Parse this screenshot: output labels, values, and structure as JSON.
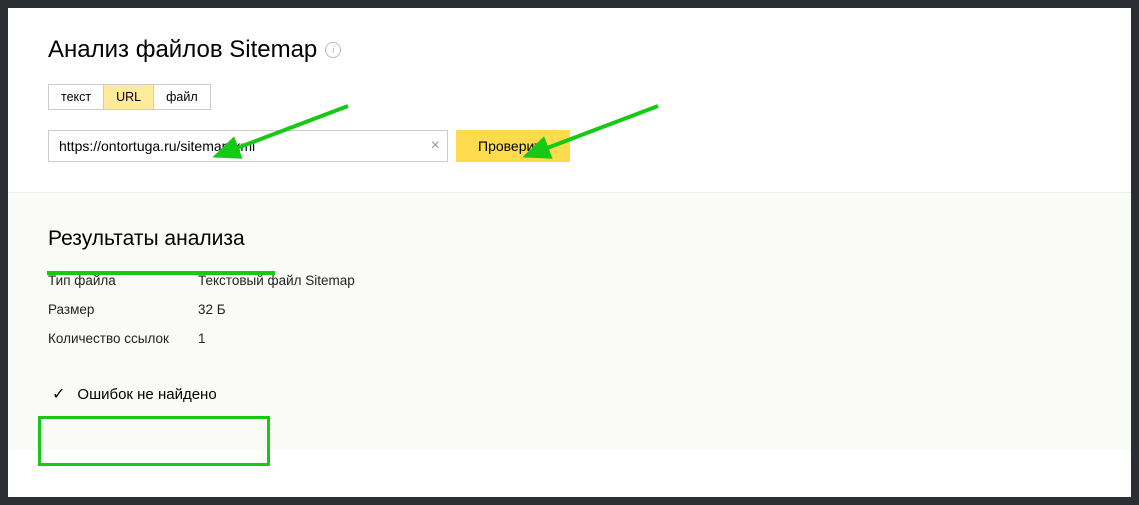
{
  "header": {
    "title": "Анализ файлов Sitemap"
  },
  "tabs": {
    "text": "текст",
    "url": "URL",
    "file": "файл"
  },
  "input": {
    "url_value": "https://ontortuga.ru/sitemap.xml",
    "check_label": "Проверить"
  },
  "results": {
    "title": "Результаты анализа",
    "rows": {
      "file_type_label": "Тип файла",
      "file_type_value": "Текстовый файл Sitemap",
      "size_label": "Размер",
      "size_value": "32 Б",
      "links_label": "Количество ссылок",
      "links_value": "1"
    },
    "status_text": "Ошибок не найдено"
  }
}
